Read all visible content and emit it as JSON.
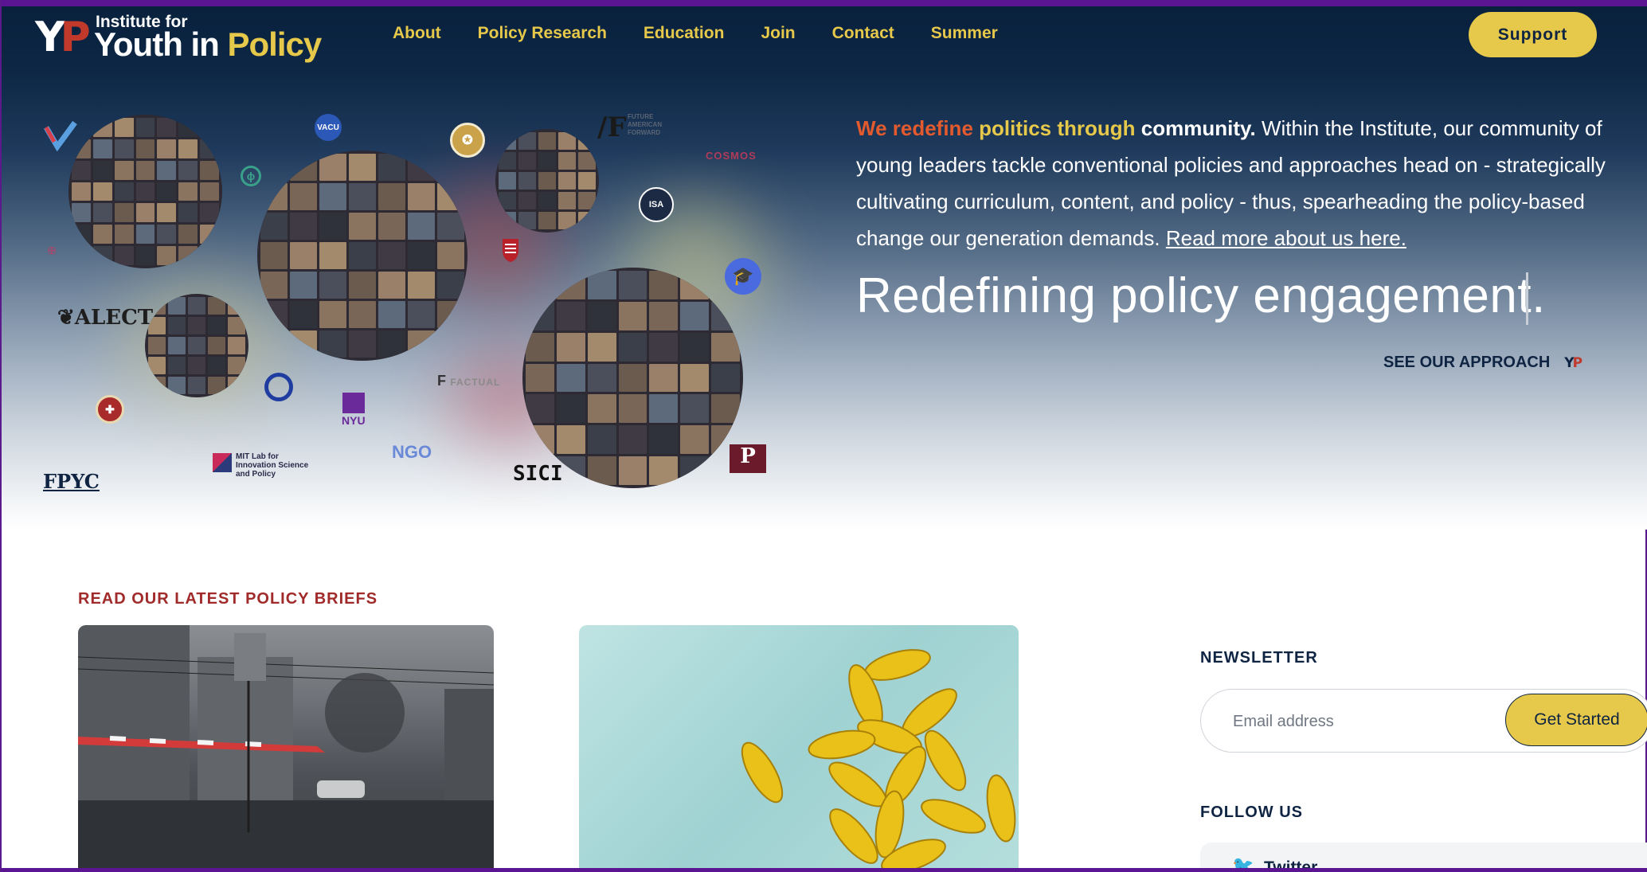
{
  "header": {
    "logo_mark_y": "Y",
    "logo_mark_p": "P",
    "logo_small": "Institute for",
    "logo_big_main": "Youth in ",
    "logo_big_accent": "Policy",
    "nav": [
      "About",
      "Policy Research",
      "Education",
      "Join",
      "Contact",
      "Summer"
    ],
    "support_label": "Support"
  },
  "hero": {
    "highlight_1": "We redefine ",
    "highlight_2": "politics through ",
    "highlight_3": "community.",
    "body": " Within the Institute, our community of young leaders tackle conventional policies and approaches head on - strategically cultivating curriculum, content, and policy - thus, spearheading the policy-based change our generation demands. ",
    "read_more": "Read more about us here.",
    "tagline": "Redefining policy engagement.",
    "approach_label": "SEE OUR APPROACH",
    "approach_mark": "YP"
  },
  "partner_logos": {
    "vacu": "VACU",
    "future_forward": "FUTURE AMERICAN FORWARD",
    "cosmos": "COSMOS",
    "isa": "ISA",
    "alect": "ALECT",
    "factual": "FACTUAL",
    "nyu": "NYU",
    "ngo": "NGO",
    "mit": "MIT Lab for Innovation Science and Policy",
    "sici": "SICI",
    "fpyc": "FPYC",
    "p_mark": "P"
  },
  "briefs": {
    "title": "READ OUR LATEST POLICY BRIEFS"
  },
  "newsletter": {
    "title": "NEWSLETTER",
    "email_placeholder": "Email address",
    "button_label": "Get Started"
  },
  "follow": {
    "title": "FOLLOW US",
    "twitter_label": "Twitter"
  },
  "colors": {
    "accent_yellow": "#e6c84a",
    "navy": "#0e2442",
    "brand_red": "#a12a2a",
    "stripe_purple": "#5b1592"
  }
}
